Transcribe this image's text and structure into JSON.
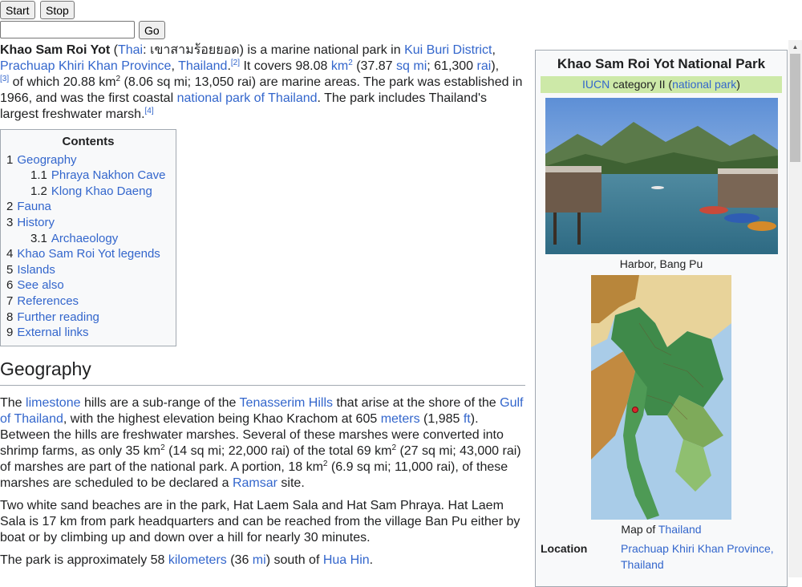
{
  "controls": {
    "start_label": "Start",
    "stop_label": "Stop",
    "go_label": "Go",
    "url_value": ""
  },
  "intro": {
    "p1": {
      "title": "Khao Sam Roi Yot",
      "paren_open": " (",
      "thai_link": "Thai",
      "thai_text": ": เขาสามร้อยยอด) is a marine national park in ",
      "district_link": "Kui Buri District",
      "comma": ", ",
      "province_link": "Prachuap Khiri Khan Province",
      "thailand_link": "Thailand",
      "period": ".",
      "ref2": "[2]",
      "covers": " It covers 98.08 ",
      "km_link": "km",
      "sup2": "2",
      "paren1": " (37.87 ",
      "sqmi_link": "sq mi",
      "semicolon": "; 61,300 ",
      "rai_link": "rai",
      "close_paren": "),",
      "ref3": "[3]",
      "of_which": " of which 20.88 km",
      "sup2b": "2",
      "marine": " (8.06 sq mi; 13,050 rai) are marine areas. The park was established in 1966, and was the first coastal ",
      "np_link": "national park of Thailand",
      "includes": ". The park includes Thailand's largest freshwater marsh.",
      "ref4": "[4]"
    }
  },
  "toc": {
    "title": "Contents",
    "items": [
      {
        "num": "1",
        "label": "Geography",
        "sub": false
      },
      {
        "num": "1.1",
        "label": "Phraya Nakhon Cave",
        "sub": true
      },
      {
        "num": "1.2",
        "label": "Klong Khao Daeng",
        "sub": true
      },
      {
        "num": "2",
        "label": "Fauna",
        "sub": false
      },
      {
        "num": "3",
        "label": "History",
        "sub": false
      },
      {
        "num": "3.1",
        "label": "Archaeology",
        "sub": true
      },
      {
        "num": "4",
        "label": "Khao Sam Roi Yot legends",
        "sub": false
      },
      {
        "num": "5",
        "label": "Islands",
        "sub": false
      },
      {
        "num": "6",
        "label": "See also",
        "sub": false
      },
      {
        "num": "7",
        "label": "References",
        "sub": false
      },
      {
        "num": "8",
        "label": "Further reading",
        "sub": false
      },
      {
        "num": "9",
        "label": "External links",
        "sub": false
      }
    ]
  },
  "geography": {
    "heading": "Geography",
    "p1": {
      "t1": "The ",
      "limestone": "limestone",
      "t2": " hills are a sub-range of the ",
      "tenasserim": "Tenasserim Hills",
      "t3": " that arise at the shore of the ",
      "gulf": "Gulf of Thailand",
      "t4": ", with the highest elevation being Khao Krachom at 605 ",
      "meters": "meters",
      "t5": " (1,985 ",
      "ft": "ft",
      "t6": "). Between the hills are freshwater marshes. Several of these marshes were converted into shrimp farms, as only 35 km",
      "s1": "2",
      "t7": " (14 sq mi; 22,000 rai) of the total 69 km",
      "s2": "2",
      "t8": " (27 sq mi; 43,000 rai) of marshes are part of the national park. A portion, 18 km",
      "s3": "2",
      "t9": " (6.9 sq mi; 11,000 rai), of these marshes are scheduled to be declared a ",
      "ramsar": "Ramsar",
      "t10": " site."
    },
    "p2": "Two white sand beaches are in the park, Hat Laem Sala and Hat Sam Phraya. Hat Laem Sala is 17 km from park headquarters and can be reached from the village Ban Pu either by boat or by climbing up and down over a hill for nearly 30 minutes.",
    "p3": {
      "t1": "The park is approximately 58 ",
      "km": "kilometers",
      "t2": " (36 ",
      "mi": "mi",
      "t3": ") south of ",
      "huahin": "Hua Hin",
      "t4": "."
    }
  },
  "infobox": {
    "title": "Khao Sam Roi Yot National Park",
    "iucn_link": "IUCN",
    "iucn_text": " category II (",
    "iucn_park_link": "national park",
    "iucn_close": ")",
    "photo_caption": "Harbor, Bang Pu",
    "map_caption_text": "Map of ",
    "map_caption_link": "Thailand",
    "location_label": "Location",
    "location_value": "Prachuap Khiri Khan Province, Thailand"
  },
  "colors": {
    "link": "#3366cc",
    "iucn_bg": "#cde9a8",
    "infobox_bg": "#f8f9fa"
  }
}
